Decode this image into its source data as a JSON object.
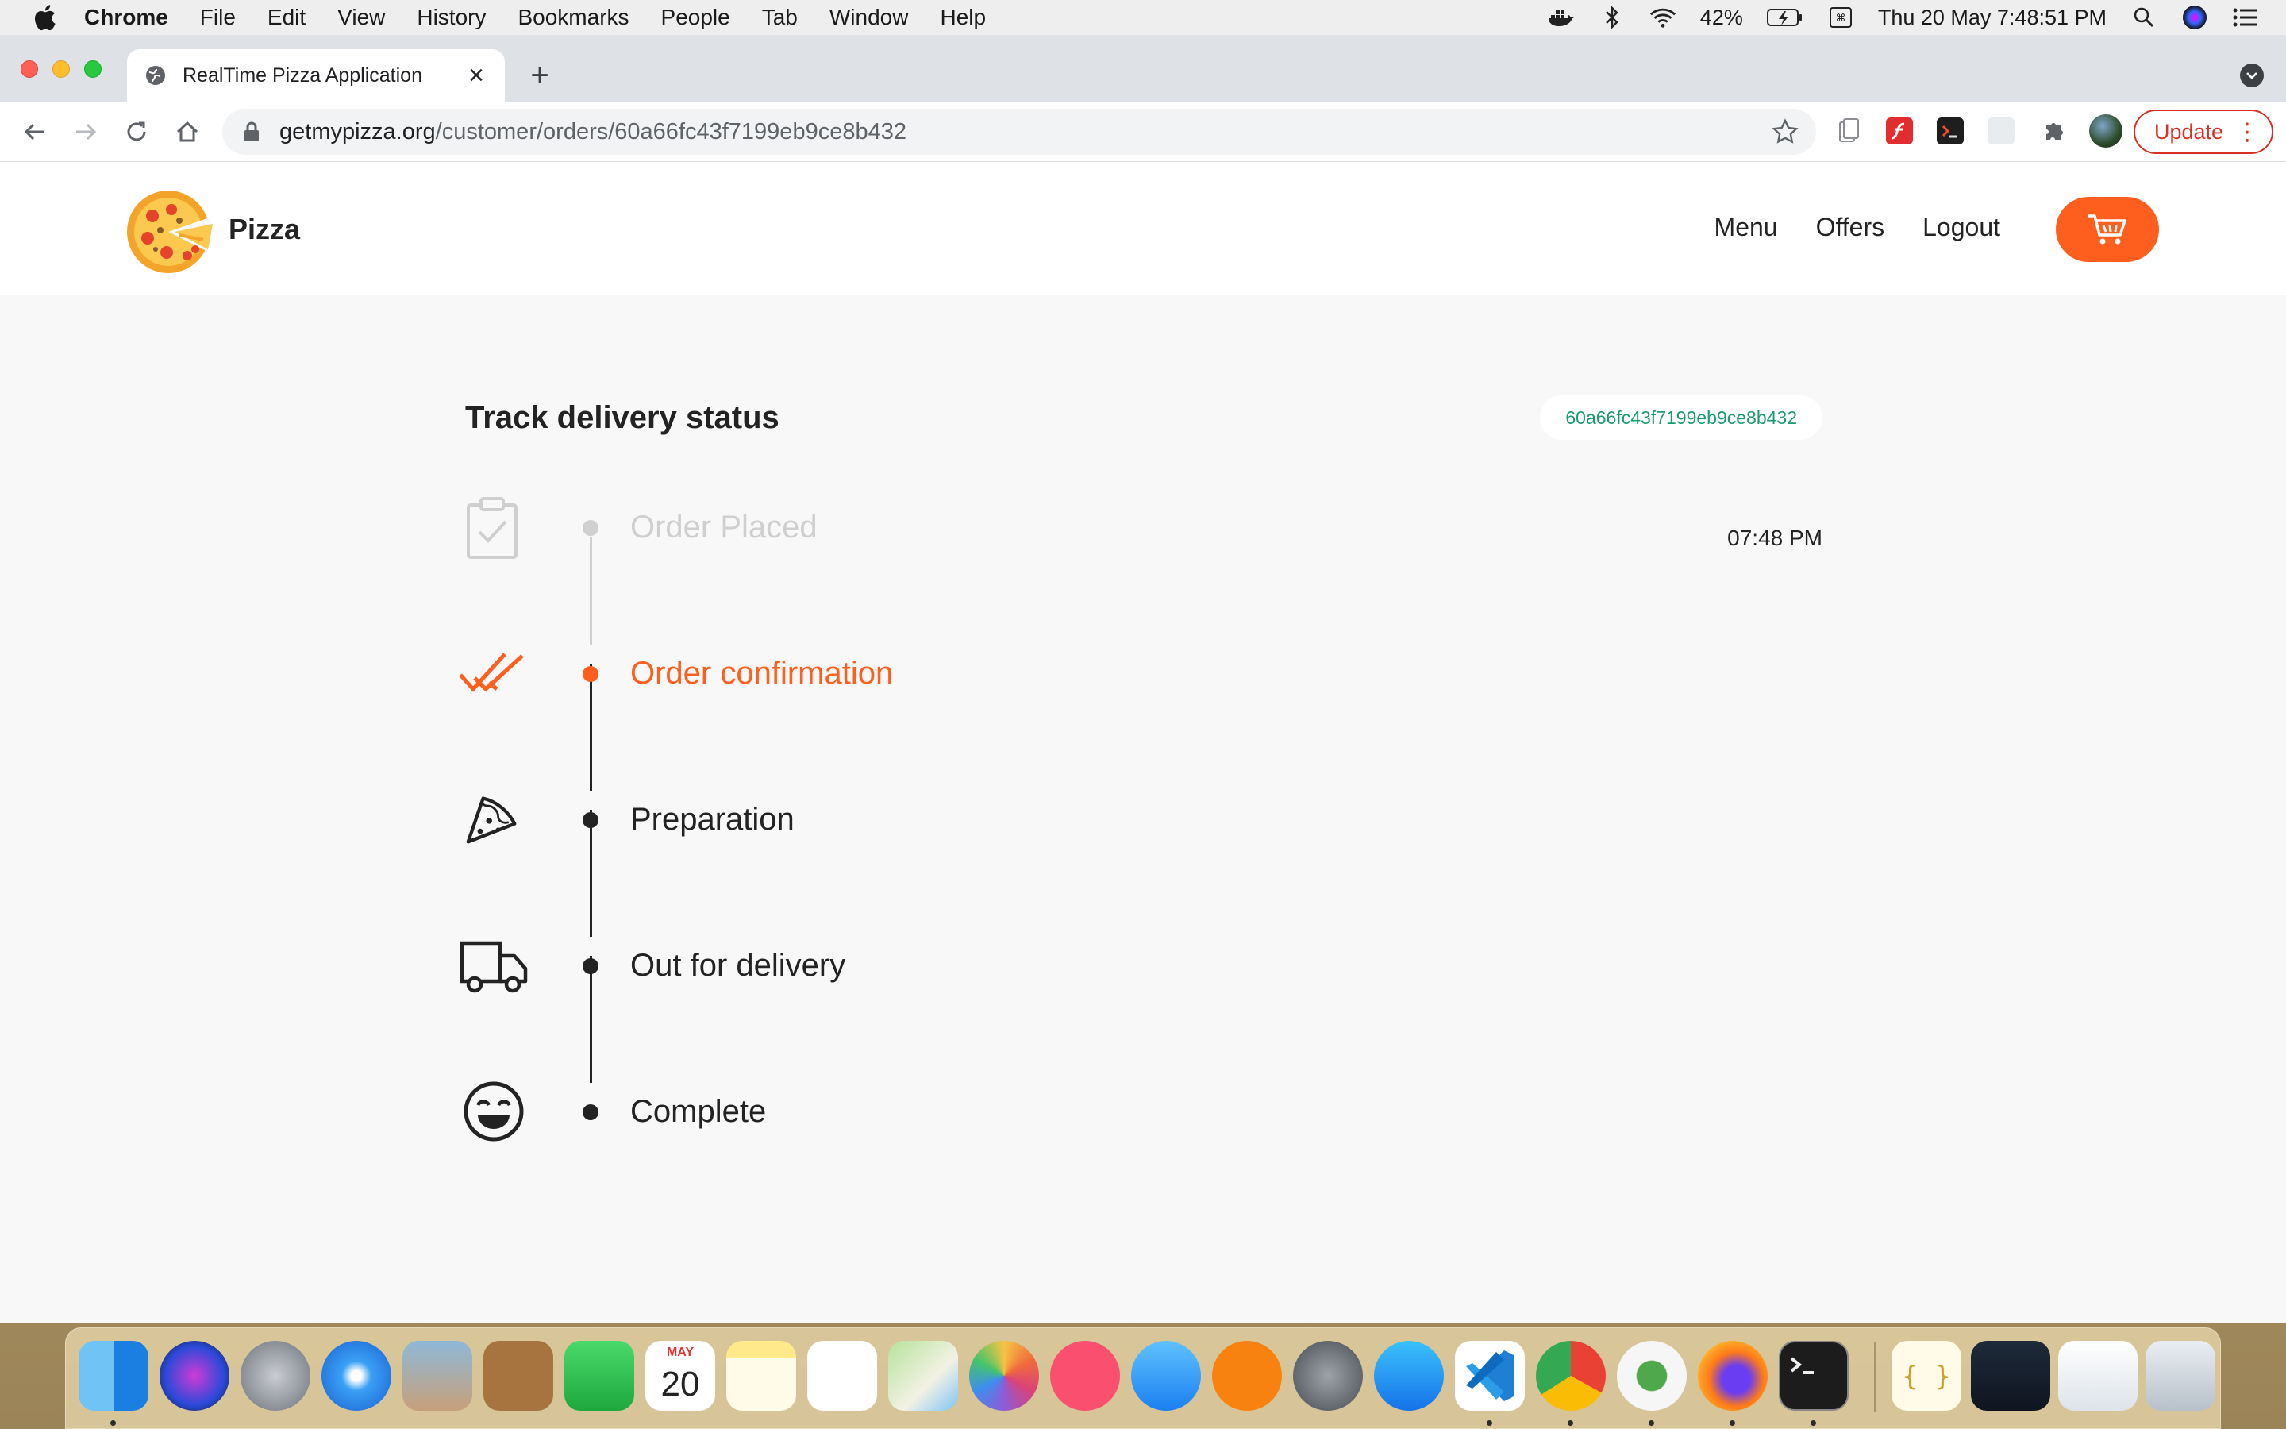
{
  "menubar": {
    "app_name": "Chrome",
    "items": [
      "File",
      "Edit",
      "View",
      "History",
      "Bookmarks",
      "People",
      "Tab",
      "Window",
      "Help"
    ],
    "battery": "42%",
    "datetime": "Thu 20 May  7:48:51 PM"
  },
  "browser": {
    "tab_title": "RealTime Pizza Application",
    "url_host": "getmypizza.org",
    "url_path": "/customer/orders/60a66fc43f7199eb9ce8b432",
    "update_label": "Update"
  },
  "site": {
    "brand": "Pizza",
    "nav": {
      "menu": "Menu",
      "offers": "Offers",
      "logout": "Logout"
    }
  },
  "tracker": {
    "title": "Track delivery status",
    "order_id": "60a66fc43f7199eb9ce8b432",
    "statuses": [
      {
        "label": "Order Placed",
        "state": "done",
        "icon": "clipboard-check-icon",
        "time": "07:48 PM"
      },
      {
        "label": "Order confirmation",
        "state": "current",
        "icon": "double-check-icon",
        "time": ""
      },
      {
        "label": "Preparation",
        "state": "pending",
        "icon": "pizza-slice-icon",
        "time": ""
      },
      {
        "label": "Out for delivery",
        "state": "pending",
        "icon": "delivery-truck-icon",
        "time": ""
      },
      {
        "label": "Complete",
        "state": "pending",
        "icon": "smiley-icon",
        "time": ""
      }
    ]
  },
  "colors": {
    "accent": "#fe5f1e",
    "order_id_text": "#1b9b6e",
    "done_text": "#cfcfcf",
    "text": "#232323"
  },
  "dock": {
    "calendar_month": "MAY",
    "calendar_day": "20"
  }
}
